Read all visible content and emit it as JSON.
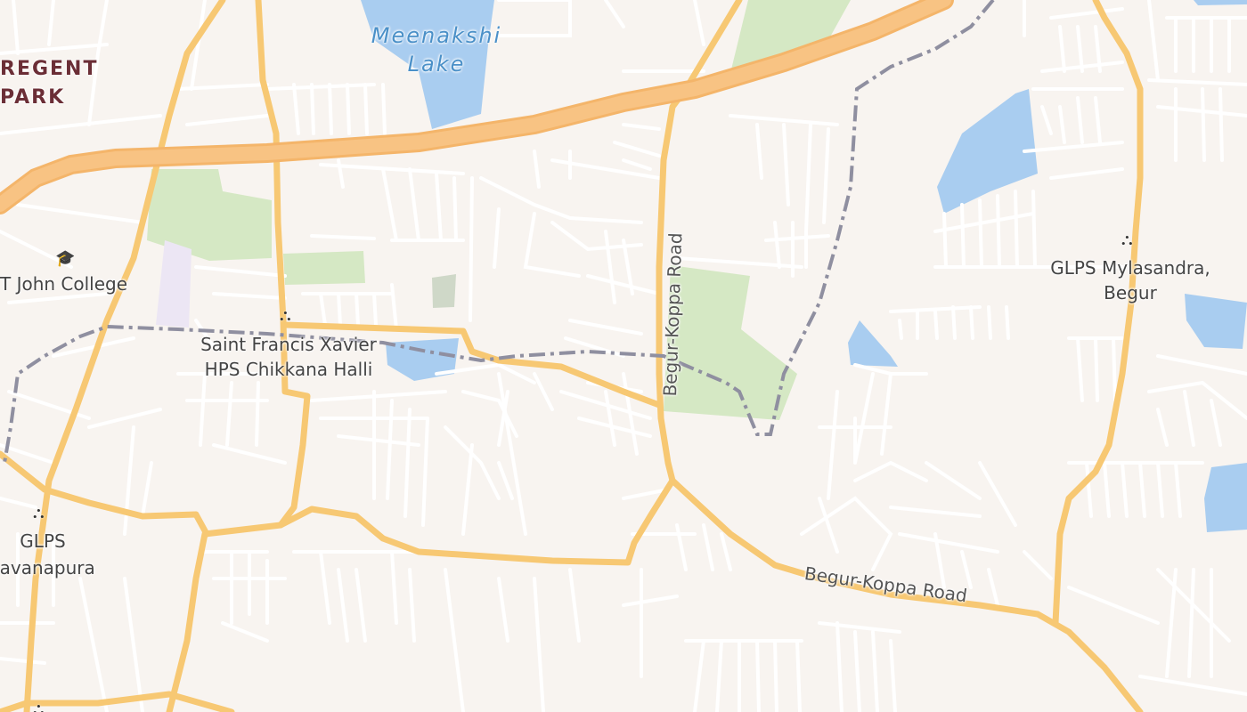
{
  "map": {
    "water_labels": {
      "lake": "Meenakshi\nLake"
    },
    "places": {
      "regent_park": "REGENT\nPARK"
    },
    "roads": {
      "begur_koppa_vertical": "Begur-Koppa Road",
      "begur_koppa_horizontal": "Begur-Koppa Road"
    },
    "pois": {
      "john_college": "T John College",
      "st_francis": "Saint Francis Xavier\nHPS Chikkana Halli",
      "glps_mylasandra": "GLPS Mylasandra,\nBegur",
      "glps_basavanapura": "GLPS\nsavanapura"
    },
    "icons": {
      "school": "school-icon",
      "college": "college-icon"
    },
    "colors": {
      "background": "#f8f4f0",
      "minor_road": "#ffffff",
      "major_road": "#f7c873",
      "highway": "#f4b56a",
      "water": "#a9cdf0",
      "park": "#d5e8c4",
      "boundary": "#8f8fa0"
    }
  }
}
